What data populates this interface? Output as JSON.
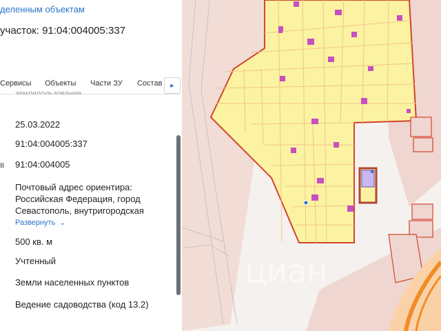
{
  "panel": {
    "top_link": "деленным объектам",
    "parcel_title": "участок: 91:04:004005:337",
    "tabs": [
      "Сервисы",
      "Объекты",
      "Части ЗУ",
      "Состав"
    ],
    "tab_arrow": "►",
    "cut_text": "землепользование",
    "rows": {
      "date": "25.03.2022",
      "cadastral_number": "91:04:004005:337",
      "quarter": "91:04:004005",
      "quarter_icon": "в",
      "address_lines": [
        "Почтовый адрес ориентира:",
        "Российская Федерация, город",
        "Севастополь, внутригородская"
      ],
      "expand_label": "Развернуть",
      "expand_icon": "chevron-down-icon",
      "area": "500 кв. м",
      "status": "Учтенный",
      "category": "Земли населенных пунктов",
      "use": "Ведение садоводства (код 13.2)"
    }
  },
  "map": {
    "watermark": "циан",
    "colors": {
      "background": "#f5f1ee",
      "plot_fill": "#fbf3a1",
      "plot_stroke": "#f1c58a",
      "boundary": "#d2442c",
      "building": "#c74fc0",
      "selected": "#b14533",
      "selected_fill": "#c9b8f0",
      "orange": "#f28c28"
    }
  }
}
